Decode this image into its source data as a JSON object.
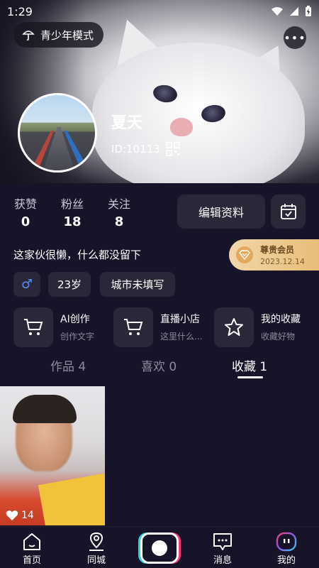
{
  "status_bar": {
    "time": "1:29"
  },
  "header": {
    "teen_mode_label": "青少年模式",
    "username": "夏天",
    "user_id": "ID:10113"
  },
  "stats": {
    "likes_label": "获赞",
    "likes_value": "0",
    "fans_label": "粉丝",
    "fans_value": "18",
    "following_label": "关注",
    "following_value": "8"
  },
  "edit_profile_label": "编辑资料",
  "bio": "这家伙很懒，什么都没留下",
  "vip": {
    "title": "尊贵会员",
    "date": "2023.12.14"
  },
  "tags": {
    "age": "23岁",
    "city": "城市未填写"
  },
  "features": [
    {
      "title": "AI创作",
      "subtitle": "创作文字",
      "icon": "cart-icon"
    },
    {
      "title": "直播小店",
      "subtitle": "这里什么...",
      "icon": "cart-icon"
    },
    {
      "title": "我的收藏",
      "subtitle": "收藏好物",
      "icon": "star-icon"
    }
  ],
  "tabs": [
    {
      "label": "作品 4"
    },
    {
      "label": "喜欢 0"
    },
    {
      "label": "收藏 1",
      "active": true
    }
  ],
  "grid": [
    {
      "likes": "14"
    }
  ],
  "bottom_nav": [
    {
      "label": "首页",
      "icon": "home-icon"
    },
    {
      "label": "同城",
      "icon": "location-icon"
    },
    {
      "label": "",
      "icon": "camera-icon"
    },
    {
      "label": "消息",
      "icon": "message-icon"
    },
    {
      "label": "我的",
      "icon": "profile-icon"
    }
  ],
  "colors": {
    "background": "#171328",
    "card": "#2a2738",
    "vip_gold": "#e8bd78",
    "accent_blue": "#5b8df5"
  }
}
